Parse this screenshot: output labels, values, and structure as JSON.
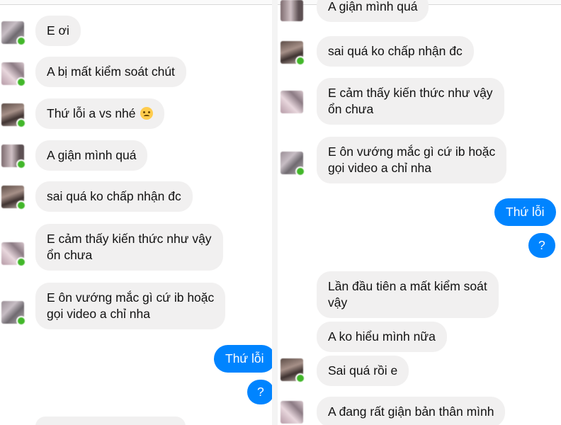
{
  "left": {
    "messages": [
      {
        "text": "E ơi"
      },
      {
        "text": "A bị mất kiểm soát chút"
      },
      {
        "text": "Thứ lỗi a vs nhé"
      },
      {
        "text": "A giận mình quá"
      },
      {
        "text": "sai quá ko chấp nhận đc"
      },
      {
        "line1": "E cảm thấy kiến thức như vậy",
        "line2": "ổn chưa"
      },
      {
        "line1": "E ôn vướng mắc gì cứ ib hoặc",
        "line2": "gọi video a chỉ nha"
      }
    ],
    "outgoing": [
      {
        "text": "Thứ lỗi"
      },
      {
        "text": "?"
      }
    ]
  },
  "right": {
    "messages": [
      {
        "text": "A giận mình quá"
      },
      {
        "text": "sai quá ko chấp nhận đc"
      },
      {
        "line1": "E cảm thấy kiến thức như vậy",
        "line2": "ổn chưa"
      },
      {
        "line1": "E ôn vướng mắc gì cứ ib hoặc",
        "line2": "gọi video a chỉ nha"
      },
      {
        "line1": "Lần đầu tiên a mất kiểm soát",
        "line2": "vậy"
      },
      {
        "text": "A ko hiểu mình nữa"
      },
      {
        "text": "Sai quá rồi e"
      },
      {
        "text": "A đang rất giận bản thân mình"
      }
    ],
    "outgoing": [
      {
        "text": "Thứ lỗi"
      },
      {
        "text": "?"
      }
    ]
  },
  "colors": {
    "incoming_bubble": "#f1f0f0",
    "outgoing_bubble": "#0084ff",
    "online_dot": "#42b72a"
  },
  "icons": {
    "emoji": "disappointed-face-emoji",
    "online": "online-status-dot"
  }
}
